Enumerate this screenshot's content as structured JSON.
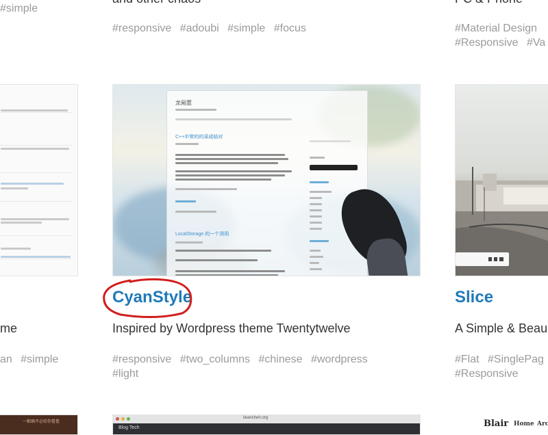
{
  "top_row": {
    "left_tag": "#simple",
    "center_desc": "and other chaos",
    "center_tags": [
      "#responsive",
      "#adoubi",
      "#simple",
      "#focus"
    ],
    "right_desc": "PC & Phone",
    "right_tags_line1": [
      "#Material Design"
    ],
    "right_tags_line2": [
      "#Responsive",
      "#Va"
    ]
  },
  "middle_row": {
    "left": {
      "desc": "me",
      "tags": [
        "an",
        "#simple"
      ]
    },
    "center": {
      "title": "CyanStyle",
      "desc": "Inspired by Wordpress theme Twentytwelve",
      "tags_line1": [
        "#responsive",
        "#two_columns",
        "#chinese",
        "#wordpress"
      ],
      "tags_line2": [
        "#light"
      ],
      "screenshot": {
        "site_title": "龙厢置",
        "post_title": "C++中常的的读成结对",
        "section_title": "LocalStorage 的一个测用"
      }
    },
    "right": {
      "title": "Slice",
      "desc": "A Simple & Beau",
      "tags_line1": [
        "#Flat",
        "#SinglePag"
      ],
      "tags_line2": [
        "#Responsive"
      ]
    }
  },
  "bottom_row": {
    "left_thumb_caption": "一都确不必给你看看",
    "center_thumb_url": "lieancheh.org",
    "center_thumb_title": "Blog Tech",
    "right_logo": "Blair",
    "right_nav": [
      "Home",
      "Arch"
    ]
  },
  "colors": {
    "title": "#1f7ab9",
    "tag": "#9a9a9a",
    "annotation": "#d21d1d"
  }
}
